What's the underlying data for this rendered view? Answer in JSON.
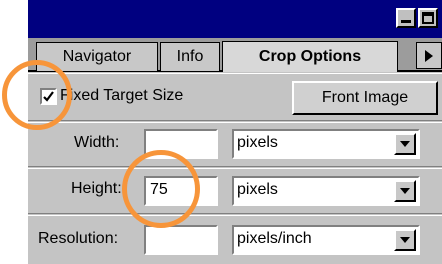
{
  "tabs": [
    "Navigator",
    "Info",
    "Crop Options"
  ],
  "fixed_target_size": {
    "label": "Fixed Target Size",
    "checked": true
  },
  "front_image_label": "Front Image",
  "width": {
    "label": "Width:",
    "value": "",
    "unit": "pixels"
  },
  "height": {
    "label": "Height:",
    "value": "75",
    "unit": "pixels"
  },
  "resolution": {
    "label": "Resolution:",
    "value": "",
    "unit": "pixels/inch"
  },
  "colors": {
    "title_bar": "#000080",
    "panel": "#c4c4c4",
    "highlight_circle": "#f7953a"
  }
}
